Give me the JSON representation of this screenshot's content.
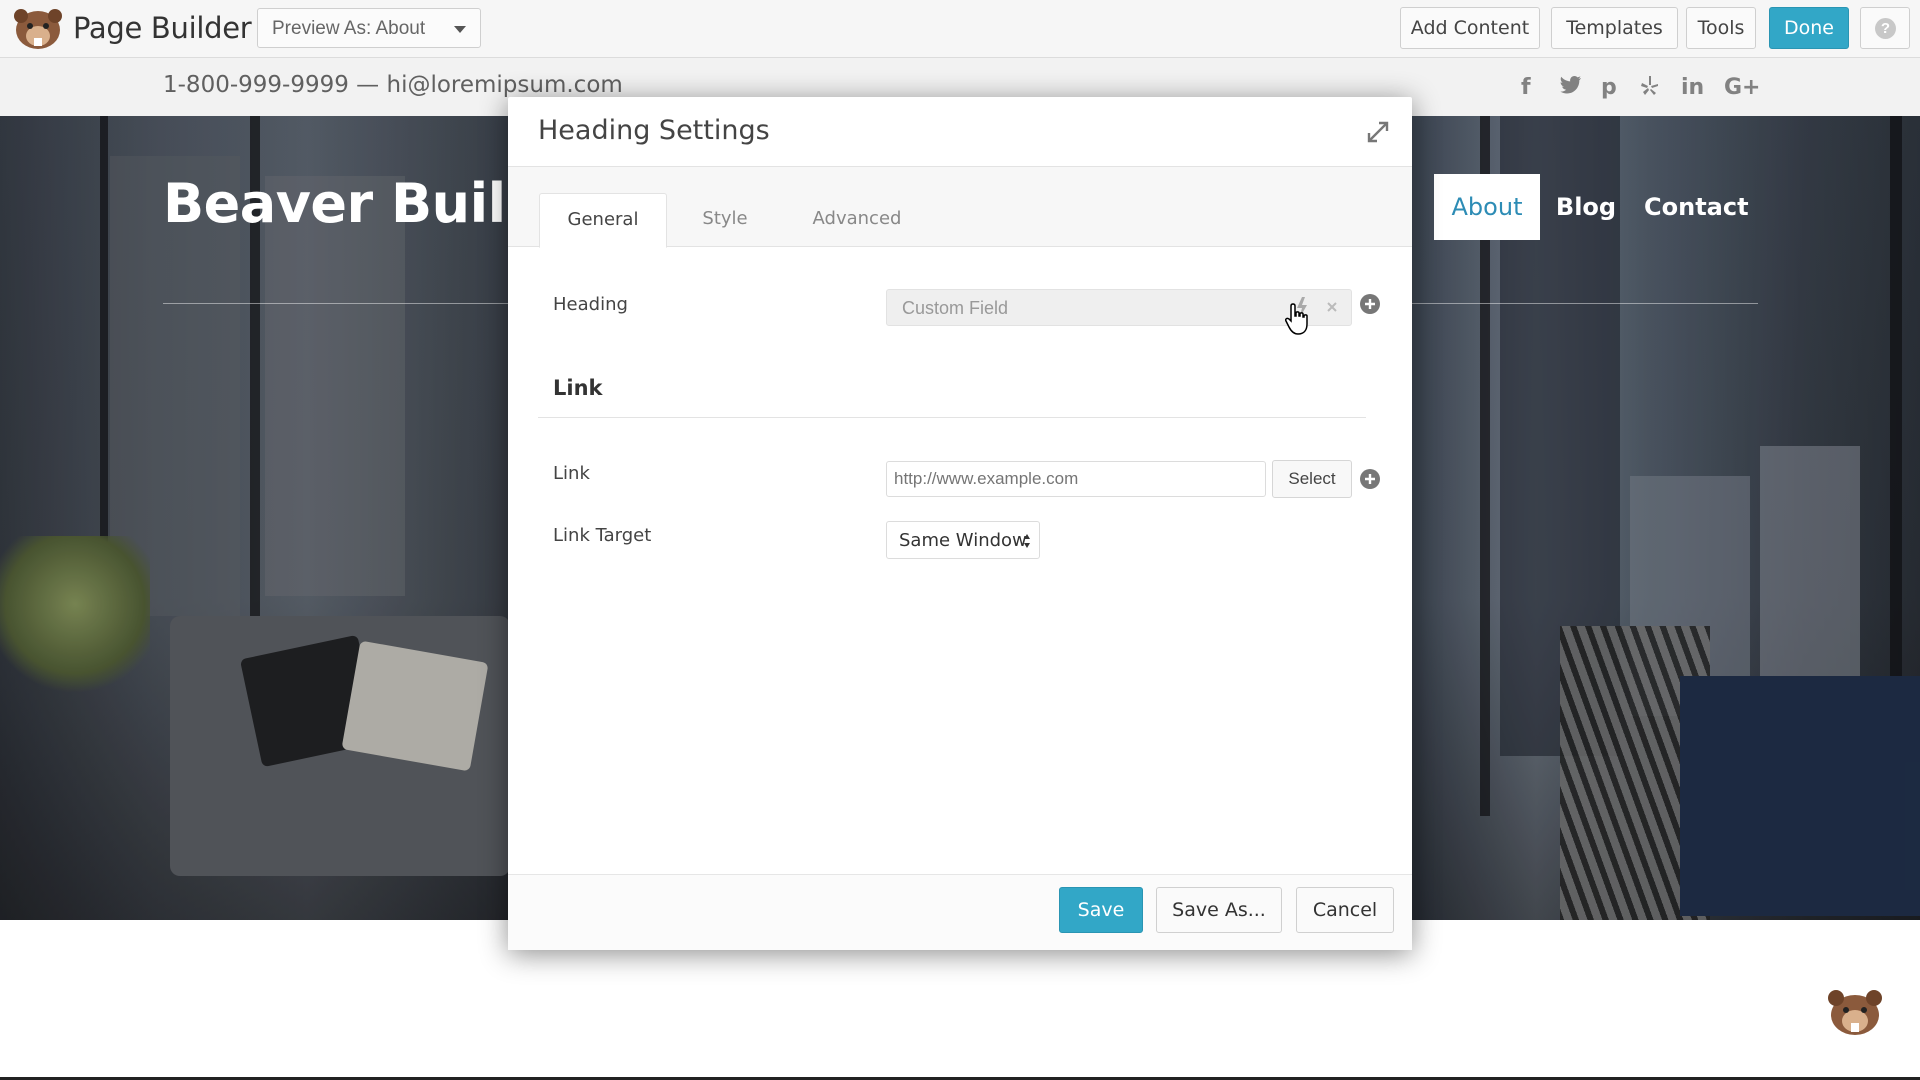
{
  "app": {
    "title": "Page Builder",
    "preview_select": "Preview As: About"
  },
  "toolbar": {
    "add_content": "Add Content",
    "templates": "Templates",
    "tools": "Tools",
    "done": "Done",
    "help_icon": "?"
  },
  "site": {
    "contact": "1-800-999-9999 — hi@loremipsum.com",
    "social": [
      "f",
      "t",
      "p",
      "yelp",
      "in",
      "G+"
    ],
    "title": "Beaver Builde",
    "nav": [
      "About",
      "Blog",
      "Contact"
    ]
  },
  "modal": {
    "title": "Heading Settings",
    "tabs": [
      "General",
      "Style",
      "Advanced"
    ],
    "active_tab": "General",
    "fields": {
      "heading_label": "Heading",
      "heading_value": "Custom Field",
      "section_title": "Link",
      "link_label": "Link",
      "link_placeholder": "http://www.example.com",
      "select_button": "Select",
      "link_target_label": "Link Target",
      "link_target_value": "Same Window"
    },
    "footer": {
      "save": "Save",
      "save_as": "Save As...",
      "cancel": "Cancel"
    }
  },
  "colors": {
    "accent": "#32a7c7",
    "nav_active_text": "#2d8cb5"
  }
}
